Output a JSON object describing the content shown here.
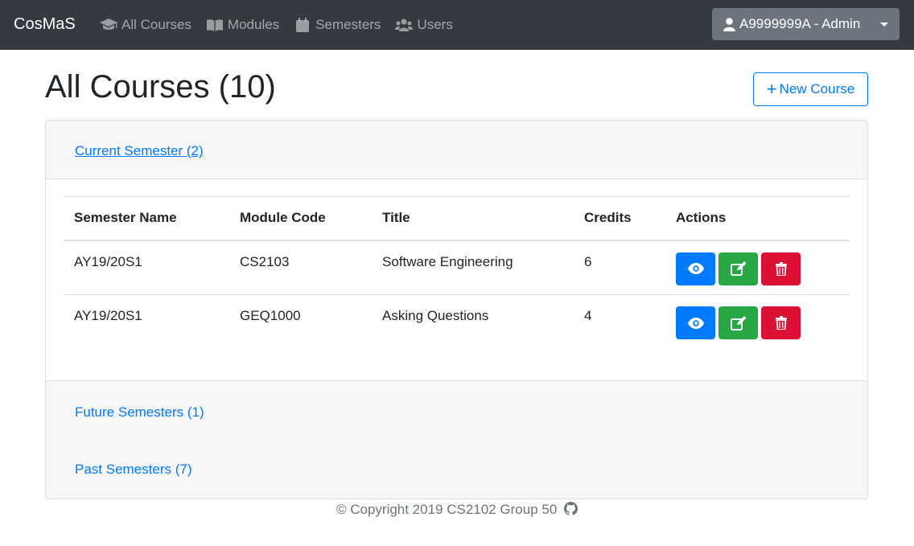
{
  "navbar": {
    "brand": "CosMaS",
    "items": [
      {
        "label": "All Courses",
        "icon": "graduation-cap-icon"
      },
      {
        "label": "Modules",
        "icon": "book-icon"
      },
      {
        "label": "Semesters",
        "icon": "calendar-icon"
      },
      {
        "label": "Users",
        "icon": "users-icon"
      }
    ],
    "user_label": "A9999999A - Admin"
  },
  "header": {
    "title": "All Courses (10)",
    "new_course_label": "New Course"
  },
  "accordion": {
    "current": {
      "label": "Current Semester (2)"
    },
    "future": {
      "label": "Future Semesters (1)"
    },
    "past": {
      "label": "Past Semesters (7)"
    }
  },
  "table": {
    "headers": [
      "Semester Name",
      "Module Code",
      "Title",
      "Credits",
      "Actions"
    ],
    "rows": [
      [
        "AY19/20S1",
        "CS2103",
        "Software Engineering",
        "6"
      ],
      [
        "AY19/20S1",
        "GEQ1000",
        "Asking Questions",
        "4"
      ]
    ]
  },
  "footer": {
    "text": "© Copyright 2019 CS2102 Group 50"
  },
  "colors": {
    "navbar": "#343a40",
    "primary": "#007bff",
    "success": "#28a745",
    "danger": "#dc0f34"
  }
}
